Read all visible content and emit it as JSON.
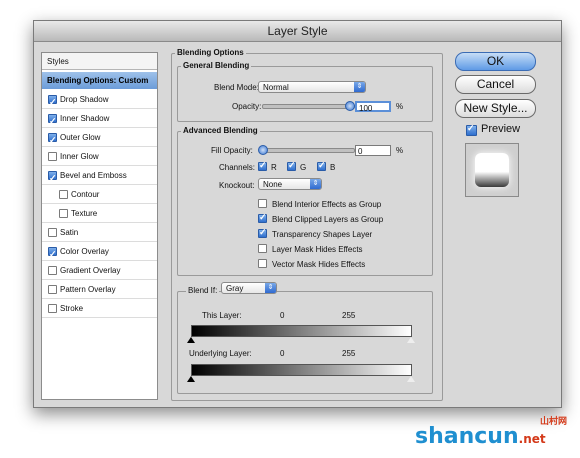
{
  "window": {
    "title": "Layer Style"
  },
  "sidebar": {
    "header": "Styles",
    "selected": "Blending Options: Custom",
    "items": [
      {
        "label": "Drop Shadow",
        "checked": true,
        "indent": false
      },
      {
        "label": "Inner Shadow",
        "checked": true,
        "indent": false
      },
      {
        "label": "Outer Glow",
        "checked": true,
        "indent": false
      },
      {
        "label": "Inner Glow",
        "checked": false,
        "indent": false
      },
      {
        "label": "Bevel and Emboss",
        "checked": true,
        "indent": false
      },
      {
        "label": "Contour",
        "checked": false,
        "indent": true
      },
      {
        "label": "Texture",
        "checked": false,
        "indent": true
      },
      {
        "label": "Satin",
        "checked": false,
        "indent": false
      },
      {
        "label": "Color Overlay",
        "checked": true,
        "indent": false
      },
      {
        "label": "Gradient Overlay",
        "checked": false,
        "indent": false
      },
      {
        "label": "Pattern Overlay",
        "checked": false,
        "indent": false
      },
      {
        "label": "Stroke",
        "checked": false,
        "indent": false
      }
    ]
  },
  "blending": {
    "title": "Blending Options",
    "general": {
      "title": "General Blending",
      "blend_mode_label": "Blend Mode:",
      "blend_mode": "Normal",
      "opacity_label": "Opacity:",
      "opacity": "100",
      "opacity_unit": "%"
    },
    "advanced": {
      "title": "Advanced Blending",
      "fill_label": "Fill Opacity:",
      "fill": "0",
      "fill_unit": "%",
      "channels_label": "Channels:",
      "channels": [
        "R",
        "G",
        "B"
      ],
      "knockout_label": "Knockout:",
      "knockout": "None",
      "options": [
        {
          "label": "Blend Interior Effects as Group",
          "checked": false
        },
        {
          "label": "Blend Clipped Layers as Group",
          "checked": true
        },
        {
          "label": "Transparency Shapes Layer",
          "checked": true
        },
        {
          "label": "Layer Mask Hides Effects",
          "checked": false
        },
        {
          "label": "Vector Mask Hides Effects",
          "checked": false
        }
      ]
    },
    "blendif": {
      "label": "Blend If:",
      "value": "Gray",
      "this_layer": {
        "label": "This Layer:",
        "low": "0",
        "high": "255"
      },
      "underlying": {
        "label": "Underlying Layer:",
        "low": "0",
        "high": "255"
      }
    }
  },
  "buttons": {
    "ok": "OK",
    "cancel": "Cancel",
    "new_style": "New Style...",
    "preview": "Preview",
    "preview_checked": true
  },
  "watermark": {
    "main": "shancun",
    "suffix": ".net",
    "cn": "山村网"
  }
}
